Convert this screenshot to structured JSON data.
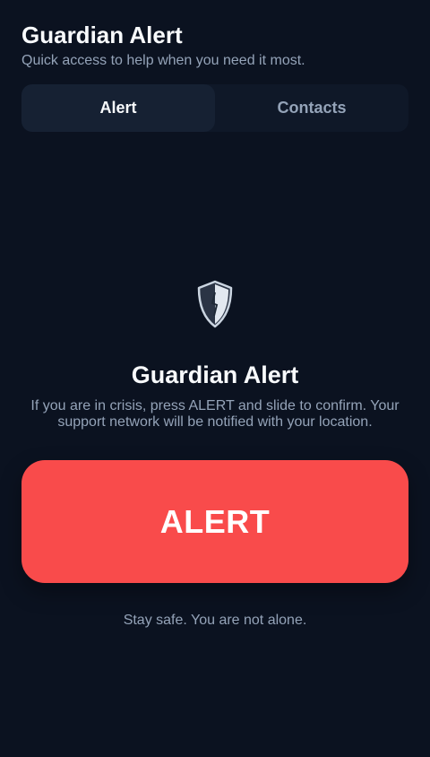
{
  "header": {
    "title": "Guardian Alert",
    "subtitle": "Quick access to help when you need it most."
  },
  "tabs": [
    {
      "label": "Alert",
      "active": true
    },
    {
      "label": "Contacts",
      "active": false
    }
  ],
  "main": {
    "icon": "shield-icon",
    "title": "Guardian Alert",
    "description": "If you are in crisis, press ALERT and slide to confirm. Your support network will be notified with your location.",
    "alert_label": "ALERT",
    "footer_note": "Stay safe. You are not alone."
  },
  "colors": {
    "background": "#0b1220",
    "alert": "#f94b4b",
    "muted_text": "#94a3b8"
  }
}
